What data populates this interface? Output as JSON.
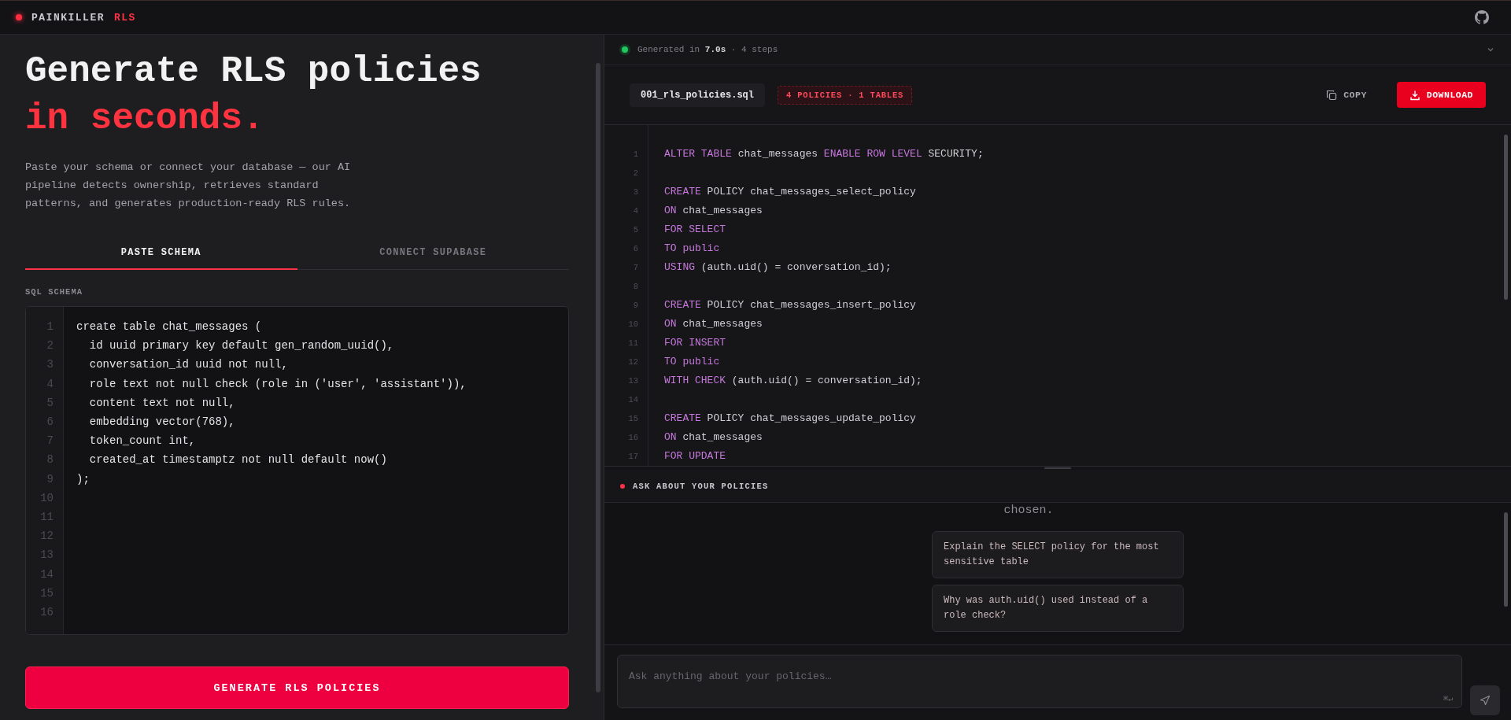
{
  "header": {
    "brand": "PAINKILLER",
    "brand_accent": "RLS"
  },
  "hero": {
    "title": "Generate RLS policies",
    "title_accent": "in seconds.",
    "description": "Paste your schema or connect your database — our AI pipeline detects ownership, retrieves standard patterns, and generates production-ready RLS rules."
  },
  "tabs": [
    {
      "label": "PASTE SCHEMA",
      "selected": true
    },
    {
      "label": "CONNECT SUPABASE",
      "selected": false
    }
  ],
  "schema_editor": {
    "label": "SQL SCHEMA",
    "lines": [
      {
        "number": "1",
        "text": "create table chat_messages ("
      },
      {
        "number": "2",
        "text": "  id uuid primary key default gen_random_uuid(),"
      },
      {
        "number": "3",
        "text": "  conversation_id uuid not null,"
      },
      {
        "number": "4",
        "text": "  role text not null check (role in ('user', 'assistant')),"
      },
      {
        "number": "5",
        "text": "  content text not null,"
      },
      {
        "number": "6",
        "text": "  embedding vector(768),"
      },
      {
        "number": "7",
        "text": "  token_count int,"
      },
      {
        "number": "8",
        "text": "  created_at timestamptz not null default now()"
      },
      {
        "number": "9",
        "text": ");"
      },
      {
        "number": "10"
      },
      {
        "number": "11"
      },
      {
        "number": "12"
      },
      {
        "number": "13"
      },
      {
        "number": "14"
      },
      {
        "number": "15"
      },
      {
        "number": "16"
      }
    ]
  },
  "generate_button": "GENERATE RLS POLICIES",
  "status": {
    "text": "Generated in **7.0s** · 4 steps"
  },
  "file_bar": {
    "filename": "001_rls_policies.sql",
    "badge": "4 POLICIES · 1 TABLES",
    "copy": "COPY",
    "download": "DOWNLOAD"
  },
  "output_lines": [
    {
      "number": "1",
      "tokens": [
        {
          "text": "ALTER TABLE",
          "kind": "keyword"
        },
        {
          "text": " chat_messages ",
          "kind": "plain"
        },
        {
          "text": "ENABLE ROW LEVEL",
          "kind": "keyword"
        },
        {
          "text": " SECURITY;",
          "kind": "plain"
        }
      ]
    },
    {
      "number": "2"
    },
    {
      "number": "3",
      "tokens": [
        {
          "text": "CREATE",
          "kind": "keyword"
        },
        {
          "text": " POLICY chat_messages_select_policy",
          "kind": "plain"
        }
      ]
    },
    {
      "number": "4",
      "tokens": [
        {
          "text": "ON",
          "kind": "keyword"
        },
        {
          "text": " chat_messages",
          "kind": "plain"
        }
      ]
    },
    {
      "number": "5",
      "tokens": [
        {
          "text": "FOR SELECT",
          "kind": "keyword"
        }
      ]
    },
    {
      "number": "6",
      "tokens": [
        {
          "text": "TO public",
          "kind": "keyword"
        }
      ]
    },
    {
      "number": "7",
      "tokens": [
        {
          "text": "USING",
          "kind": "keyword"
        },
        {
          "text": " (auth.uid() = conversation_id);",
          "kind": "plain"
        }
      ]
    },
    {
      "number": "8"
    },
    {
      "number": "9",
      "tokens": [
        {
          "text": "CREATE",
          "kind": "keyword"
        },
        {
          "text": " POLICY chat_messages_insert_policy",
          "kind": "plain"
        }
      ]
    },
    {
      "number": "10",
      "tokens": [
        {
          "text": "ON",
          "kind": "keyword"
        },
        {
          "text": " chat_messages",
          "kind": "plain"
        }
      ]
    },
    {
      "number": "11",
      "tokens": [
        {
          "text": "FOR INSERT",
          "kind": "keyword"
        }
      ]
    },
    {
      "number": "12",
      "tokens": [
        {
          "text": "TO public",
          "kind": "keyword"
        }
      ]
    },
    {
      "number": "13",
      "tokens": [
        {
          "text": "WITH CHECK",
          "kind": "keyword"
        },
        {
          "text": " (auth.uid() = conversation_id);",
          "kind": "plain"
        }
      ]
    },
    {
      "number": "14"
    },
    {
      "number": "15",
      "tokens": [
        {
          "text": "CREATE",
          "kind": "keyword"
        },
        {
          "text": " POLICY chat_messages_update_policy",
          "kind": "plain"
        }
      ]
    },
    {
      "number": "16",
      "tokens": [
        {
          "text": "ON",
          "kind": "keyword"
        },
        {
          "text": " chat_messages",
          "kind": "plain"
        }
      ]
    },
    {
      "number": "17",
      "tokens": [
        {
          "text": "FOR UPDATE",
          "kind": "keyword"
        }
      ]
    }
  ],
  "chat": {
    "title": "ASK ABOUT YOUR POLICIES",
    "intro_fragment": "chosen.",
    "suggestions": [
      "Explain the SELECT policy for the most sensitive table",
      "Why was auth.uid() used instead of a role check?"
    ],
    "input": {
      "placeholder": "Ask anything about your policies…",
      "shortcut": "⌘↵"
    }
  }
}
